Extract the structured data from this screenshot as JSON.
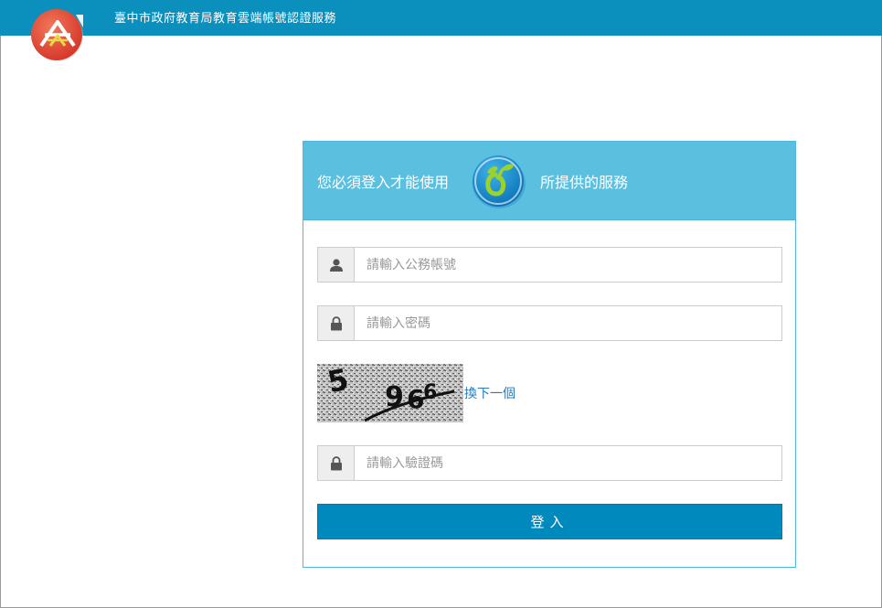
{
  "header": {
    "site_title": "臺中市政府教育局教育雲端帳號認證服務",
    "logo_icon": "taichung-city-logo-icon"
  },
  "card": {
    "header_left": "您必須登入才能使用",
    "header_right": "所提供的服務",
    "service_logo_icon": "service-sprout-logo-icon",
    "username": {
      "icon": "user-icon",
      "placeholder": "請輸入公務帳號",
      "value": ""
    },
    "password": {
      "icon": "lock-icon",
      "placeholder": "請輸入密碼",
      "value": ""
    },
    "captcha": {
      "refresh_label": "換下一個"
    },
    "verification": {
      "icon": "lock-icon",
      "placeholder": "請輸入驗證碼",
      "value": ""
    },
    "login_label": "登入"
  },
  "colors": {
    "topbar": "#0b8fbd",
    "card_header": "#5bc0e0",
    "button": "#0089bc",
    "link": "#2a7ab8"
  }
}
